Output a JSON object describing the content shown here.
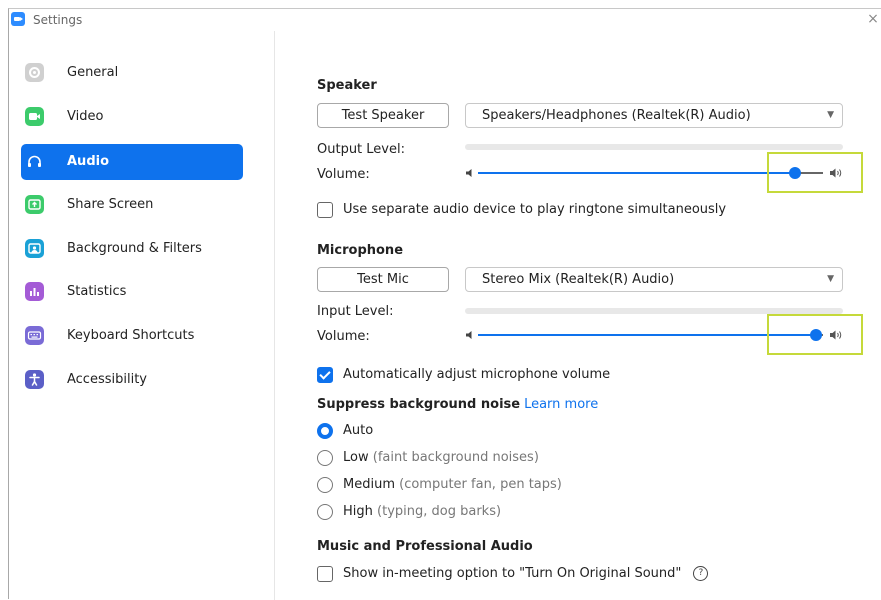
{
  "window": {
    "title": "Settings",
    "close_glyph": "×"
  },
  "sidebar": {
    "items": [
      {
        "label": "General",
        "icon": "gear-icon",
        "color": "#d0d0d0",
        "active": false
      },
      {
        "label": "Video",
        "icon": "video-icon",
        "color": "#3ccb6b",
        "active": false
      },
      {
        "label": "Audio",
        "icon": "headphones-icon",
        "color": "#0e72ed",
        "active": true
      },
      {
        "label": "Share Screen",
        "icon": "share-screen-icon",
        "color": "#3ccb6b",
        "active": false
      },
      {
        "label": "Background & Filters",
        "icon": "background-icon",
        "color": "#1aa1d6",
        "active": false
      },
      {
        "label": "Statistics",
        "icon": "statistics-icon",
        "color": "#a45bd6",
        "active": false
      },
      {
        "label": "Keyboard Shortcuts",
        "icon": "keyboard-icon",
        "color": "#7a6bd6",
        "active": false
      },
      {
        "label": "Accessibility",
        "icon": "accessibility-icon",
        "color": "#5b5fc7",
        "active": false
      }
    ]
  },
  "speaker": {
    "title": "Speaker",
    "test_button": "Test Speaker",
    "device": "Speakers/Headphones (Realtek(R) Audio)",
    "output_level_label": "Output Level:",
    "volume_label": "Volume:",
    "volume_fraction": 0.92,
    "separate_device_label": "Use separate audio device to play ringtone simultaneously",
    "separate_device_checked": false
  },
  "microphone": {
    "title": "Microphone",
    "test_button": "Test Mic",
    "device": "Stereo Mix (Realtek(R) Audio)",
    "input_level_label": "Input Level:",
    "volume_label": "Volume:",
    "volume_fraction": 0.98,
    "auto_adjust_label": "Automatically adjust microphone volume",
    "auto_adjust_checked": true
  },
  "noise": {
    "title": "Suppress background noise",
    "learn_more": "Learn more",
    "options": [
      {
        "label": "Auto",
        "hint": "",
        "selected": true
      },
      {
        "label": "Low",
        "hint": "(faint background noises)",
        "selected": false
      },
      {
        "label": "Medium",
        "hint": "(computer fan, pen taps)",
        "selected": false
      },
      {
        "label": "High",
        "hint": "(typing, dog barks)",
        "selected": false
      }
    ]
  },
  "music": {
    "title": "Music and Professional Audio",
    "original_sound_label": "Show in-meeting option to \"Turn On Original Sound\"",
    "original_sound_checked": false
  },
  "colors": {
    "accent": "#0e72ed",
    "highlight": "#c5d93a"
  }
}
